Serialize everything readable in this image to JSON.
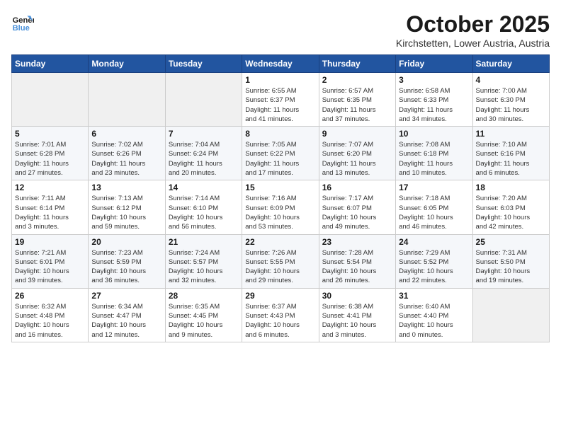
{
  "header": {
    "logo_line1": "General",
    "logo_line2": "Blue",
    "month_title": "October 2025",
    "location": "Kirchstetten, Lower Austria, Austria"
  },
  "days_of_week": [
    "Sunday",
    "Monday",
    "Tuesday",
    "Wednesday",
    "Thursday",
    "Friday",
    "Saturday"
  ],
  "weeks": [
    [
      {
        "num": "",
        "info": ""
      },
      {
        "num": "",
        "info": ""
      },
      {
        "num": "",
        "info": ""
      },
      {
        "num": "1",
        "info": "Sunrise: 6:55 AM\nSunset: 6:37 PM\nDaylight: 11 hours\nand 41 minutes."
      },
      {
        "num": "2",
        "info": "Sunrise: 6:57 AM\nSunset: 6:35 PM\nDaylight: 11 hours\nand 37 minutes."
      },
      {
        "num": "3",
        "info": "Sunrise: 6:58 AM\nSunset: 6:33 PM\nDaylight: 11 hours\nand 34 minutes."
      },
      {
        "num": "4",
        "info": "Sunrise: 7:00 AM\nSunset: 6:30 PM\nDaylight: 11 hours\nand 30 minutes."
      }
    ],
    [
      {
        "num": "5",
        "info": "Sunrise: 7:01 AM\nSunset: 6:28 PM\nDaylight: 11 hours\nand 27 minutes."
      },
      {
        "num": "6",
        "info": "Sunrise: 7:02 AM\nSunset: 6:26 PM\nDaylight: 11 hours\nand 23 minutes."
      },
      {
        "num": "7",
        "info": "Sunrise: 7:04 AM\nSunset: 6:24 PM\nDaylight: 11 hours\nand 20 minutes."
      },
      {
        "num": "8",
        "info": "Sunrise: 7:05 AM\nSunset: 6:22 PM\nDaylight: 11 hours\nand 17 minutes."
      },
      {
        "num": "9",
        "info": "Sunrise: 7:07 AM\nSunset: 6:20 PM\nDaylight: 11 hours\nand 13 minutes."
      },
      {
        "num": "10",
        "info": "Sunrise: 7:08 AM\nSunset: 6:18 PM\nDaylight: 11 hours\nand 10 minutes."
      },
      {
        "num": "11",
        "info": "Sunrise: 7:10 AM\nSunset: 6:16 PM\nDaylight: 11 hours\nand 6 minutes."
      }
    ],
    [
      {
        "num": "12",
        "info": "Sunrise: 7:11 AM\nSunset: 6:14 PM\nDaylight: 11 hours\nand 3 minutes."
      },
      {
        "num": "13",
        "info": "Sunrise: 7:13 AM\nSunset: 6:12 PM\nDaylight: 10 hours\nand 59 minutes."
      },
      {
        "num": "14",
        "info": "Sunrise: 7:14 AM\nSunset: 6:10 PM\nDaylight: 10 hours\nand 56 minutes."
      },
      {
        "num": "15",
        "info": "Sunrise: 7:16 AM\nSunset: 6:09 PM\nDaylight: 10 hours\nand 53 minutes."
      },
      {
        "num": "16",
        "info": "Sunrise: 7:17 AM\nSunset: 6:07 PM\nDaylight: 10 hours\nand 49 minutes."
      },
      {
        "num": "17",
        "info": "Sunrise: 7:18 AM\nSunset: 6:05 PM\nDaylight: 10 hours\nand 46 minutes."
      },
      {
        "num": "18",
        "info": "Sunrise: 7:20 AM\nSunset: 6:03 PM\nDaylight: 10 hours\nand 42 minutes."
      }
    ],
    [
      {
        "num": "19",
        "info": "Sunrise: 7:21 AM\nSunset: 6:01 PM\nDaylight: 10 hours\nand 39 minutes."
      },
      {
        "num": "20",
        "info": "Sunrise: 7:23 AM\nSunset: 5:59 PM\nDaylight: 10 hours\nand 36 minutes."
      },
      {
        "num": "21",
        "info": "Sunrise: 7:24 AM\nSunset: 5:57 PM\nDaylight: 10 hours\nand 32 minutes."
      },
      {
        "num": "22",
        "info": "Sunrise: 7:26 AM\nSunset: 5:55 PM\nDaylight: 10 hours\nand 29 minutes."
      },
      {
        "num": "23",
        "info": "Sunrise: 7:28 AM\nSunset: 5:54 PM\nDaylight: 10 hours\nand 26 minutes."
      },
      {
        "num": "24",
        "info": "Sunrise: 7:29 AM\nSunset: 5:52 PM\nDaylight: 10 hours\nand 22 minutes."
      },
      {
        "num": "25",
        "info": "Sunrise: 7:31 AM\nSunset: 5:50 PM\nDaylight: 10 hours\nand 19 minutes."
      }
    ],
    [
      {
        "num": "26",
        "info": "Sunrise: 6:32 AM\nSunset: 4:48 PM\nDaylight: 10 hours\nand 16 minutes."
      },
      {
        "num": "27",
        "info": "Sunrise: 6:34 AM\nSunset: 4:47 PM\nDaylight: 10 hours\nand 12 minutes."
      },
      {
        "num": "28",
        "info": "Sunrise: 6:35 AM\nSunset: 4:45 PM\nDaylight: 10 hours\nand 9 minutes."
      },
      {
        "num": "29",
        "info": "Sunrise: 6:37 AM\nSunset: 4:43 PM\nDaylight: 10 hours\nand 6 minutes."
      },
      {
        "num": "30",
        "info": "Sunrise: 6:38 AM\nSunset: 4:41 PM\nDaylight: 10 hours\nand 3 minutes."
      },
      {
        "num": "31",
        "info": "Sunrise: 6:40 AM\nSunset: 4:40 PM\nDaylight: 10 hours\nand 0 minutes."
      },
      {
        "num": "",
        "info": ""
      }
    ]
  ]
}
